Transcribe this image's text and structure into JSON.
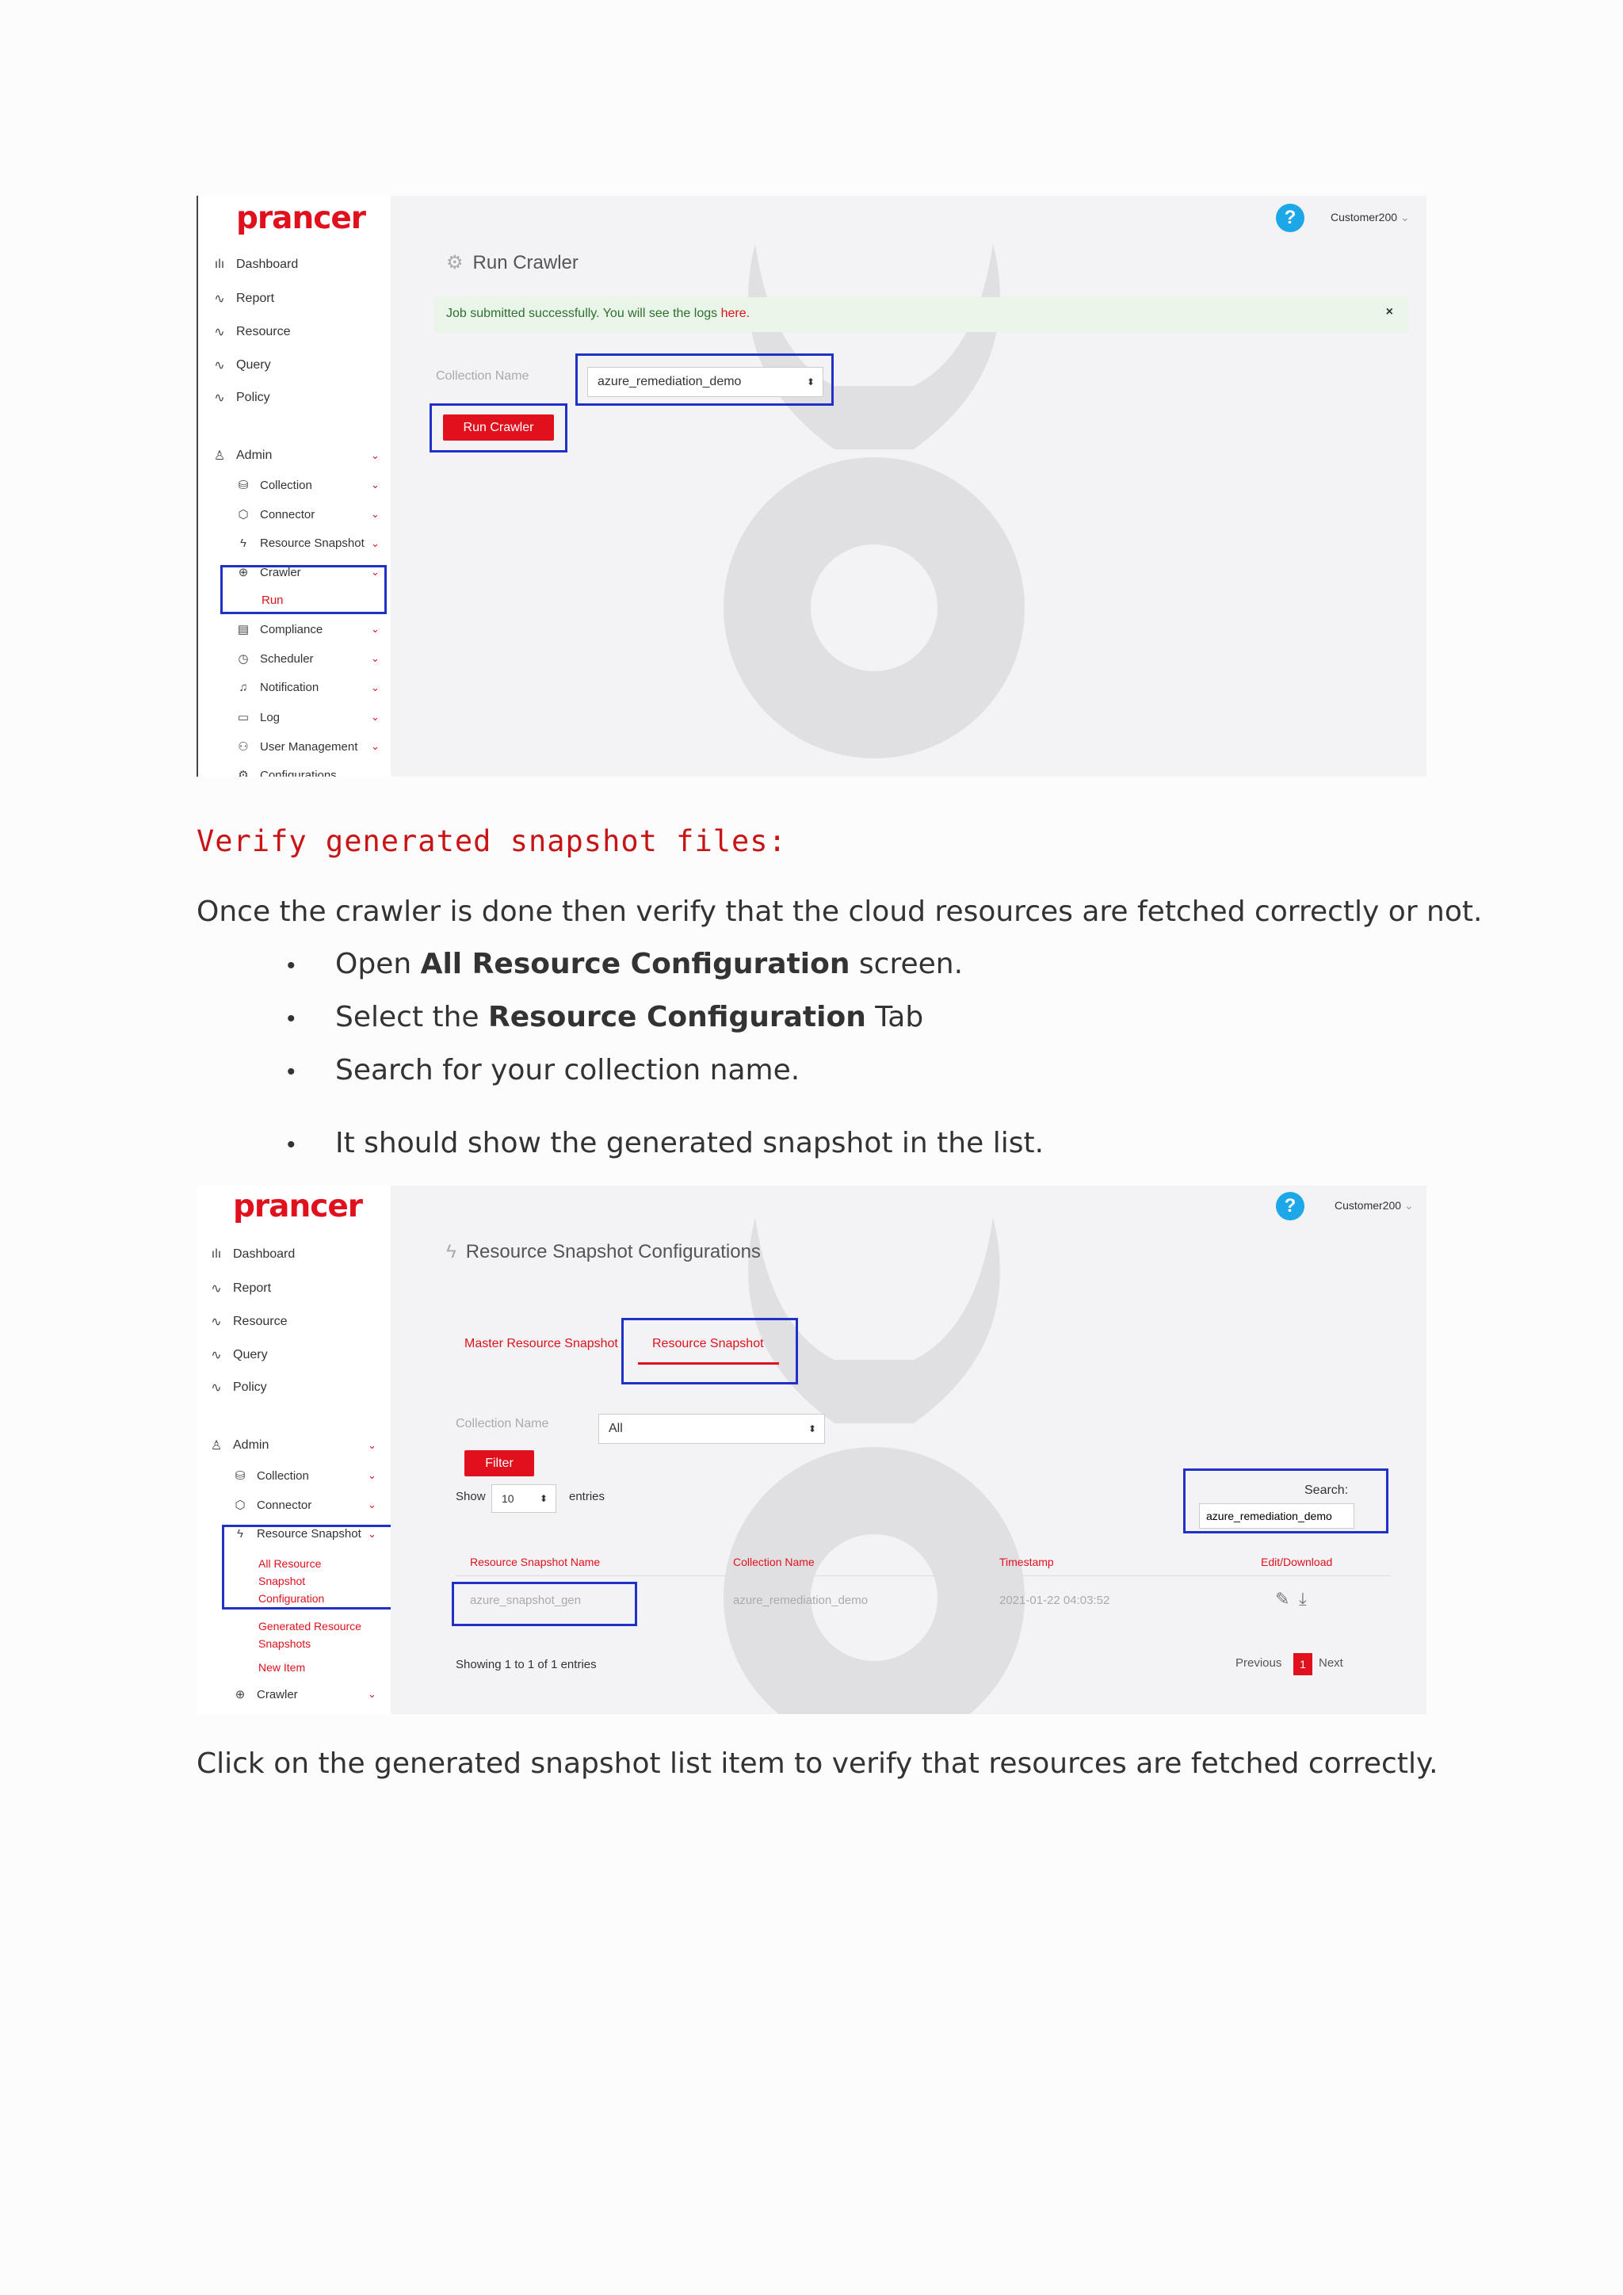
{
  "screenshot1": {
    "logo": "prancer",
    "nav": [
      "Dashboard",
      "Report",
      "Resource",
      "Query",
      "Policy"
    ],
    "admin": "Admin",
    "subnav": [
      "Collection",
      "Connector",
      "Resource Snapshot",
      "Crawler"
    ],
    "crawler_sub": "Run",
    "subnav2": [
      "Compliance",
      "Scheduler",
      "Notification",
      "Log",
      "User Management",
      "Configurations"
    ],
    "user": "Customer200",
    "help": "?",
    "page_title": "Run Crawler",
    "alert_text": "Job submitted successfully. You will see the logs ",
    "alert_link": "here.",
    "alert_close": "×",
    "collection_label": "Collection Name",
    "collection_value": "azure_remediation_demo",
    "run_button": "Run Crawler"
  },
  "heading": "Verify generated snapshot files:",
  "intro": "Once the crawler is done then verify that the cloud resources are fetched correctly or not.",
  "steps": [
    {
      "pre": "Open ",
      "bold": "All Resource Configuration",
      "post": " screen."
    },
    {
      "pre": "Select the ",
      "bold": "Resource Configuration",
      "post": " Tab"
    },
    {
      "pre": "Search for your collection name.",
      "bold": "",
      "post": ""
    },
    {
      "pre": "It should show the generated snapshot in the list.",
      "bold": "",
      "post": ""
    }
  ],
  "screenshot2": {
    "logo": "prancer",
    "nav": [
      "Dashboard",
      "Report",
      "Resource",
      "Query",
      "Policy"
    ],
    "admin": "Admin",
    "subnav": [
      "Collection",
      "Connector",
      "Resource Snapshot"
    ],
    "rs_sub": [
      "All Resource Snapshot Configuration",
      "Generated Resource Snapshots",
      "New Item"
    ],
    "rs_sub_lines": [
      [
        "All Resource",
        "Snapshot",
        "Configuration"
      ],
      [
        "Generated Resource",
        "Snapshots"
      ],
      [
        "New Item"
      ]
    ],
    "crawler": "Crawler",
    "user": "Customer200",
    "help": "?",
    "page_title": "Resource Snapshot Configurations",
    "tab_master": "Master Resource Snapshot",
    "tab_resource": "Resource Snapshot",
    "collection_label": "Collection Name",
    "collection_value": "All",
    "filter_button": "Filter",
    "show_label": "Show",
    "show_value": "10",
    "entries_label": "entries",
    "search_label": "Search:",
    "search_value": "azure_remediation_demo",
    "columns": [
      "Resource Snapshot Name",
      "Collection Name",
      "Timestamp",
      "Edit/Download"
    ],
    "row": [
      "azure_snapshot_gen",
      "azure_remediation_demo",
      "2021-01-22 04:03:52"
    ],
    "showing": "Showing 1 to 1 of 1 entries",
    "prev": "Previous",
    "page": "1",
    "next": "Next"
  },
  "closing": "Click on the generated snapshot list item to verify that resources are fetched correctly.",
  "colors": {
    "brand_red": "#e0101c",
    "highlight_blue": "#1f32c8",
    "heading_red": "#c81414",
    "help_blue": "#1ea7e8"
  }
}
